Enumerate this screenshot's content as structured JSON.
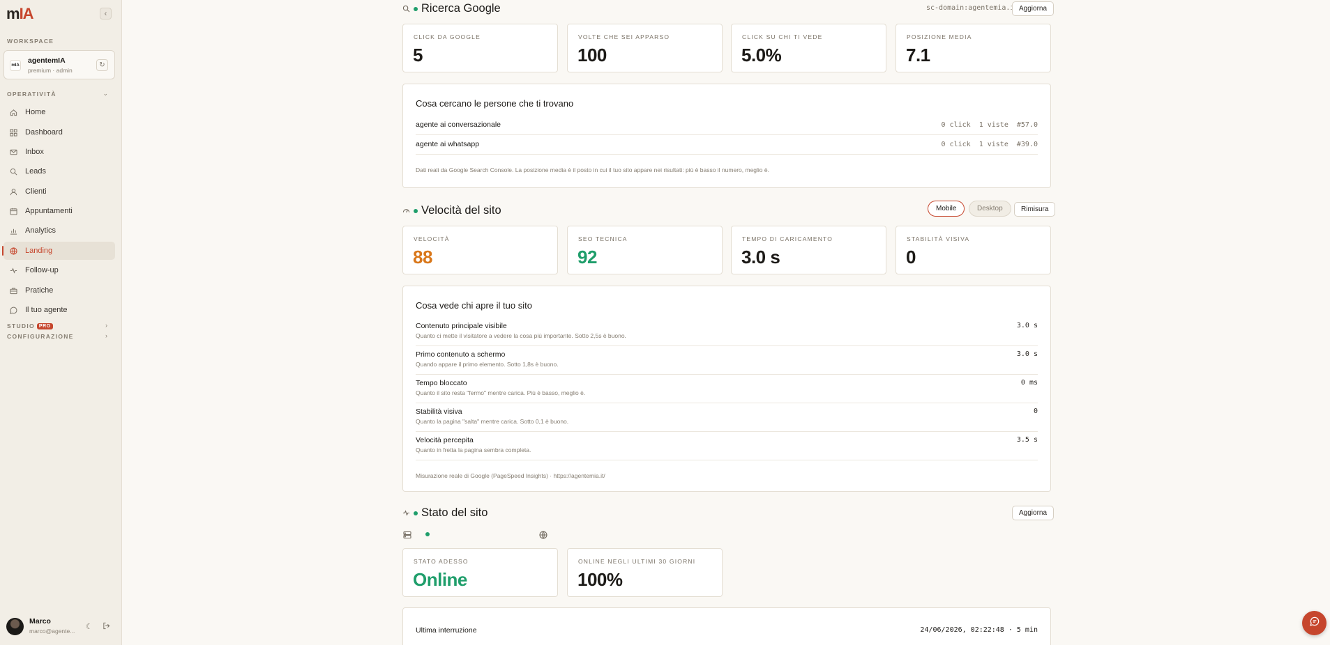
{
  "brand": {
    "logo_main": "m",
    "logo_accent": "IA"
  },
  "sidebar": {
    "workspace_label": "WORKSPACE",
    "workspace": {
      "name": "agentemIA",
      "sub": "premium · admin",
      "logo_text": "mIA"
    },
    "section_operativita": "OPERATIVITÀ",
    "items": [
      {
        "label": "Home",
        "icon": "home-icon"
      },
      {
        "label": "Dashboard",
        "icon": "grid-icon"
      },
      {
        "label": "Inbox",
        "icon": "mail-icon"
      },
      {
        "label": "Leads",
        "icon": "search-icon"
      },
      {
        "label": "Clienti",
        "icon": "user-icon"
      },
      {
        "label": "Appuntamenti",
        "icon": "calendar-icon"
      },
      {
        "label": "Analytics",
        "icon": "bar-chart-icon"
      },
      {
        "label": "Landing",
        "icon": "globe-icon",
        "active": true
      },
      {
        "label": "Follow-up",
        "icon": "activity-icon"
      },
      {
        "label": "Pratiche",
        "icon": "briefcase-icon"
      },
      {
        "label": "Il tuo agente",
        "icon": "chat-icon"
      }
    ],
    "section_studio": "STUDIO",
    "pro_badge": "PRO",
    "section_config": "CONFIGURAZIONE",
    "user": {
      "name": "Marco",
      "email": "marco@agente..."
    }
  },
  "google": {
    "title": "Ricerca Google",
    "domain": "sc-domain:agentemia.it",
    "refresh_label": "Aggiorna",
    "stats": [
      {
        "label": "CLICK DA GOOGLE",
        "value": "5"
      },
      {
        "label": "VOLTE CHE SEI APPARSO",
        "value": "100"
      },
      {
        "label": "CLICK SU CHI TI VEDE",
        "value": "5.0%"
      },
      {
        "label": "POSIZIONE MEDIA",
        "value": "7.1"
      }
    ],
    "queries_title": "Cosa cercano le persone che ti trovano",
    "queries": [
      {
        "query": "agente ai conversazionale",
        "stats": "0 click  1 viste  #57.0"
      },
      {
        "query": "agente ai whatsapp",
        "stats": "0 click  1 viste  #39.0"
      }
    ],
    "note": "Dati reali da Google Search Console. La posizione media è il posto in cui il tuo sito appare nei risultati: più è basso il numero, meglio è."
  },
  "speed": {
    "title": "Velocità del sito",
    "mobile_label": "Mobile",
    "desktop_label": "Desktop",
    "remeasure_label": "Rimisura",
    "stats": [
      {
        "label": "VELOCITÀ",
        "value": "88",
        "color": "#d9771a"
      },
      {
        "label": "SEO TECNICA",
        "value": "92",
        "color": "#1f9e6b"
      },
      {
        "label": "TEMPO DI CARICAMENTO",
        "value": "3.0 s",
        "color": "#1c1a17"
      },
      {
        "label": "STABILITÀ VISIVA",
        "value": "0",
        "color": "#1c1a17"
      }
    ],
    "panel_title": "Cosa vede chi apre il tuo sito",
    "metrics": [
      {
        "label": "Contenuto principale visibile",
        "sub": "Quanto ci mette il visitatore a vedere la cosa più importante. Sotto 2,5s è buono.",
        "value": "3.0 s"
      },
      {
        "label": "Primo contenuto a schermo",
        "sub": "Quando appare il primo elemento. Sotto 1,8s è buono.",
        "value": "3.0 s"
      },
      {
        "label": "Tempo bloccato",
        "sub": "Quanto il sito resta \"fermo\" mentre carica. Più è basso, meglio è.",
        "value": "0 ms"
      },
      {
        "label": "Stabilità visiva",
        "sub": "Quanto la pagina \"salta\" mentre carica. Sotto 0,1 è buono.",
        "value": "0"
      },
      {
        "label": "Velocità percepita",
        "sub": "Quanto in fretta la pagina sembra completa.",
        "value": "3.5 s"
      }
    ],
    "note": "Misurazione reale di Google (PageSpeed Insights) · https://agentemia.it/"
  },
  "status": {
    "title": "Stato del sito",
    "refresh_label": "Aggiorna",
    "stats": [
      {
        "label": "STATO ADESSO",
        "value": "Online",
        "color": "#1f9e6b"
      },
      {
        "label": "ONLINE NEGLI ULTIMI 30 GIORNI",
        "value": "100%",
        "color": "#1c1a17"
      }
    ],
    "last_outage_label": "Ultima interruzione",
    "last_outage_value": "24/06/2026, 02:22:48 · 5 min"
  },
  "colors": {
    "accent": "#c6462d",
    "success": "#1f9e6b",
    "warning": "#d9771a"
  }
}
